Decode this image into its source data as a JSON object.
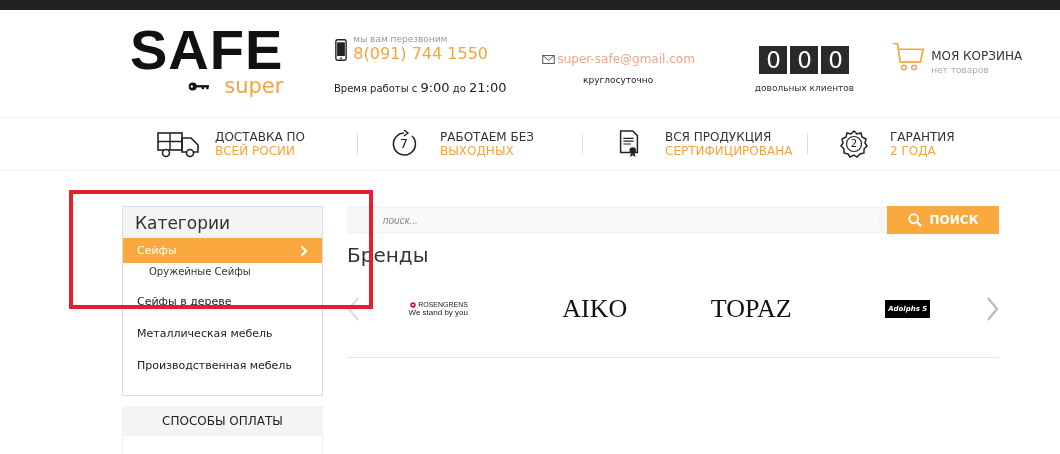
{
  "logo": {
    "title": "SAFE",
    "subtitle": "super"
  },
  "contact": {
    "callback_note": "мы вам перезвоним",
    "phone": "8(091) 744 1550",
    "hours": [
      "Время работы с",
      "9:00",
      "до",
      "21:00"
    ],
    "email": "super-safe@gmail.com",
    "email_note": "круглосуточно"
  },
  "counter": {
    "digits": [
      "0",
      "0",
      "0"
    ],
    "caption": "довольных клиентов"
  },
  "cart": {
    "title": "МОЯ КОРЗИНА",
    "status": "нет товаров"
  },
  "features": [
    {
      "kind": "truck",
      "line1": "ДОСТАВКА ПО",
      "line2": "ВСЕЙ РОСИИ"
    },
    {
      "kind": "clock",
      "badge": "7",
      "line1": "РАБОТАЕМ БЕЗ",
      "line2": "ВЫХОДНЫХ"
    },
    {
      "kind": "certificate",
      "line1": "ВСЯ ПРОДУКЦИЯ",
      "line2": "СЕРТИФИЦИРОВАНА"
    },
    {
      "kind": "seal",
      "badge": "2",
      "line1": "ГАРАНТИЯ",
      "line2": "2 ГОДА"
    }
  ],
  "categories": {
    "title": "Категории",
    "items": [
      {
        "label": "Сейфы",
        "selected": true,
        "children": [
          {
            "label": "Оружейные Сейфы",
            "selected": false
          }
        ]
      },
      {
        "label": "Сейфы в дереве",
        "selected": false
      },
      {
        "label": "Металлическая мебель",
        "selected": false
      },
      {
        "label": "Производственная мебель",
        "selected": false
      }
    ]
  },
  "payment": {
    "title": "СПОСОБЫ ОПЛАТЫ"
  },
  "search": {
    "placeholder": "поиск...",
    "button": "ПОИСК"
  },
  "brands": {
    "title": "Бренды",
    "logos": [
      {
        "kind": "rosengrens",
        "name": "ROSENGRENS",
        "tagline": "We stand by you"
      },
      {
        "kind": "serif",
        "name": "AIKO"
      },
      {
        "kind": "serif",
        "name": "TOPAZ"
      },
      {
        "kind": "block",
        "name": "Adolphs S"
      }
    ]
  },
  "highlight": {
    "shown": true
  }
}
